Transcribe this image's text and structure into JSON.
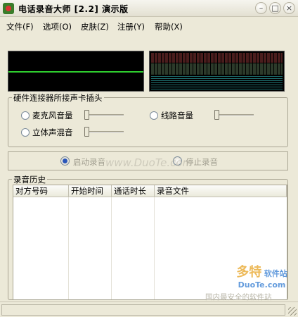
{
  "window": {
    "title": "电话录音大师 [2.2] 演示版",
    "minimize_glyph": "–",
    "maximize_glyph": "□",
    "close_glyph": "×"
  },
  "menu": [
    "文件(F)",
    "选项(O)",
    "皮肤(Z)",
    "注册(Y)",
    "帮助(X)"
  ],
  "visualizer": {
    "waveform_color": "#2ecc2e",
    "spectrum_colors": [
      "#4a1d1d",
      "#2c3a2a",
      "#1e6b6b"
    ]
  },
  "hardware_group": {
    "label": "硬件连接器所接声卡插头",
    "options": [
      {
        "label": "麦克风音量",
        "selected": false,
        "slider_level": 0
      },
      {
        "label": "线路音量",
        "selected": false,
        "slider_level": 0
      },
      {
        "label": "立体声混音",
        "selected": false,
        "slider_level": 0
      }
    ]
  },
  "controls": {
    "options": [
      {
        "label": "启动录音",
        "selected": true
      },
      {
        "label": "停止录音",
        "selected": false
      }
    ]
  },
  "history": {
    "label": "录音历史",
    "columns": [
      "对方号码",
      "开始时间",
      "通话时长",
      "录音文件"
    ],
    "rows": []
  },
  "watermarks": {
    "center": "www.DuoTe.com",
    "brand_big": "多特",
    "brand_small": "DuoTe.com",
    "brand_tag": "软件站",
    "footer": "国内最安全的软件站"
  }
}
